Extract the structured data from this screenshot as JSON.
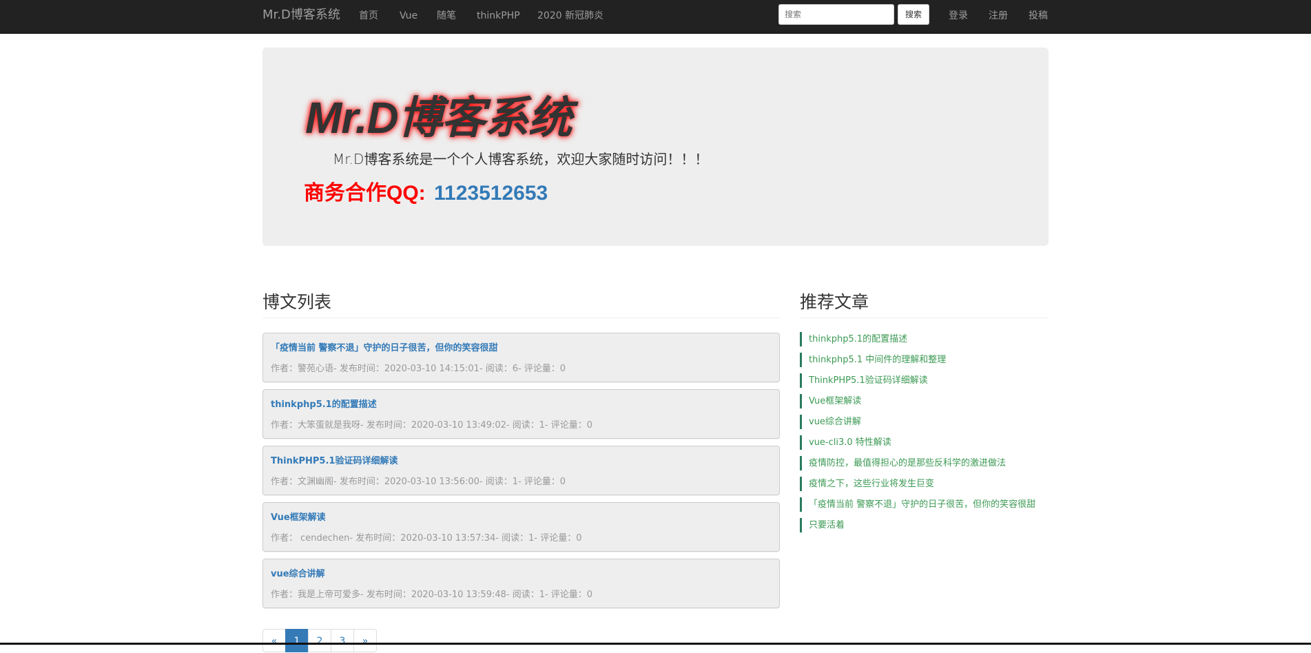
{
  "navbar": {
    "brand": "Mr.D博客系统",
    "links": [
      "首页",
      "Vue",
      "随笔",
      "thinkPHP",
      "2020 新冠肺炎"
    ],
    "search_placeholder": "搜索",
    "search_button": "搜索",
    "right_links": [
      "登录",
      "注册",
      "投稿"
    ]
  },
  "jumbotron": {
    "title": "Mr.D博客系统",
    "description": "Mr.D博客系统是一个个人博客系统，欢迎大家随时访问！！！",
    "contact_label": "商务合作QQ:",
    "contact_number": "1123512653"
  },
  "posts_section": {
    "title": "博文列表",
    "posts": [
      {
        "title": "「疫情当前 警察不退」守护的日子很苦，但你的笑容很甜",
        "meta": "作者：警苑心语- 发布时间：2020-03-10 14:15:01- 阅读：6- 评论量：0"
      },
      {
        "title": "thinkphp5.1的配置描述",
        "meta": "作者：大笨蛋就是我呀- 发布时间：2020-03-10 13:49:02- 阅读：1- 评论量：0"
      },
      {
        "title": "ThinkPHP5.1验证码详细解读",
        "meta": "作者：文渊幽阁- 发布时间：2020-03-10 13:56:00- 阅读：1- 评论量：0"
      },
      {
        "title": "Vue框架解读",
        "meta": "作者： cendechen- 发布时间：2020-03-10 13:57:34- 阅读：1- 评论量：0"
      },
      {
        "title": "vue综合讲解",
        "meta": "作者：我是上帝可爱多- 发布时间：2020-03-10 13:59:48- 阅读：1- 评论量：0"
      }
    ]
  },
  "recommended": {
    "title": "推荐文章",
    "items": [
      "thinkphp5.1的配置描述",
      "thinkphp5.1 中间件的理解和整理",
      "ThinkPHP5.1验证码详细解读",
      "Vue框架解读",
      "vue综合讲解",
      "vue-cli3.0 特性解读",
      "疫情防控，最值得担心的是那些反科学的激进做法",
      "疫情之下，这些行业将发生巨变",
      "「疫情当前 警察不退」守护的日子很苦，但你的笑容很甜",
      "只要活着"
    ]
  },
  "pagination": {
    "prev": "«",
    "pages": [
      "1",
      "2",
      "3"
    ],
    "next": "»",
    "active_page": "1"
  },
  "colors": {
    "navbar_bg": "#222222",
    "link_blue": "#337ab7",
    "contact_red": "#ff0000",
    "recommend_green": "#3c9a54"
  }
}
